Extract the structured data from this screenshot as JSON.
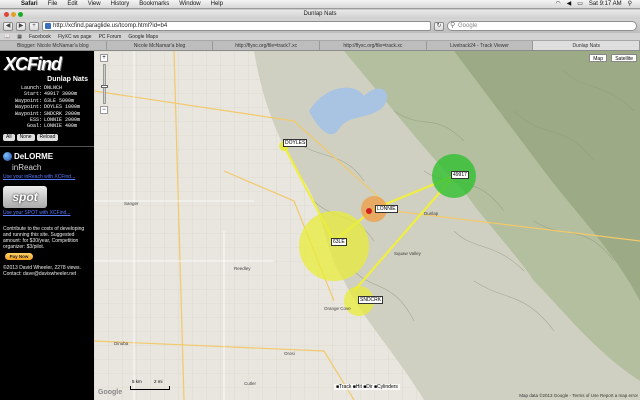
{
  "menubar": {
    "app": "Safari",
    "items": [
      "File",
      "Edit",
      "View",
      "History",
      "Bookmarks",
      "Window",
      "Help"
    ],
    "clock": "Sat 9:17 AM"
  },
  "window": {
    "title": "Dunlap Nats"
  },
  "toolbar": {
    "url": "http://xcfind.paraglide.us/tcomp.html?id=b4",
    "search_placeholder": "Google"
  },
  "bookmarks": [
    "Facebook",
    "FlyXC ws page",
    "PC Forum",
    "Google Maps"
  ],
  "tabs": [
    {
      "label": "Blogger: Nicole McNamar'a blog",
      "active": false
    },
    {
      "label": "Nicole McNamar'a blog",
      "active": false
    },
    {
      "label": "http://flyxc.org/file=track7.xc",
      "active": false
    },
    {
      "label": "http://flyxc.org/file=track.xc",
      "active": false
    },
    {
      "label": "Livetrack24 - Track Viewer",
      "active": false
    },
    {
      "label": "Dunlap Nats",
      "active": true
    }
  ],
  "sidebar": {
    "logo": "XCFind",
    "task_name": "Dunlap Nats",
    "turnpoints": [
      {
        "k": "Launch:",
        "v": "DNLNCH"
      },
      {
        "k": "Start:",
        "v": "49917 3000m"
      },
      {
        "k": "Waypoint:",
        "v": "63LE 5000m"
      },
      {
        "k": "Waypoint:",
        "v": "DOYLES 1000m"
      },
      {
        "k": "Waypoint:",
        "v": "SNDCRK 2000m"
      },
      {
        "k": "ESS:",
        "v": "LONNIE 2000m"
      },
      {
        "k": "Goal:",
        "v": "LONNIE 400m"
      }
    ],
    "buttons": [
      "All",
      "None",
      "Reload"
    ],
    "delorme": "DeLORME",
    "inreach": "inReach",
    "delorme_link": "Use your inReach with XCFind...",
    "spot": "spot",
    "spot_link": "Use your SPOT with XCFind...",
    "contribute": "Contribute to the costs of developing and running this site. Suggested amount: for $30/year, Competition organizer: $3/pilot.",
    "paynow": "Pay Now",
    "copyright": "©2013 David Wheeler, 2278 views.",
    "contact": "Contact: dave@daviswheeler.net"
  },
  "map": {
    "type_buttons": [
      "Map",
      "Satellite"
    ],
    "waypoints": [
      "DOYLES",
      "LONNIE",
      "63LE",
      "SNDCRK",
      "49917"
    ],
    "places": [
      "Dinuba",
      "Reedley",
      "Sanger",
      "Orosi",
      "Cutler",
      "Orange Cove",
      "Squaw Valley",
      "Dunlap"
    ],
    "legend": "■Track ■Hit ■Dir ■Cylinders",
    "footer": "Map data ©2013 Google - Terms of Use  Report a map error",
    "google": "Google",
    "scale_labels": [
      "5 km",
      "2 mi"
    ]
  },
  "colors": {
    "sidebar_bg": "#000000",
    "link": "#5a7cff",
    "cylinder_yellow": "#e8ec3a",
    "cylinder_green": "#2fc12f",
    "cylinder_orange": "#f29a3a"
  }
}
